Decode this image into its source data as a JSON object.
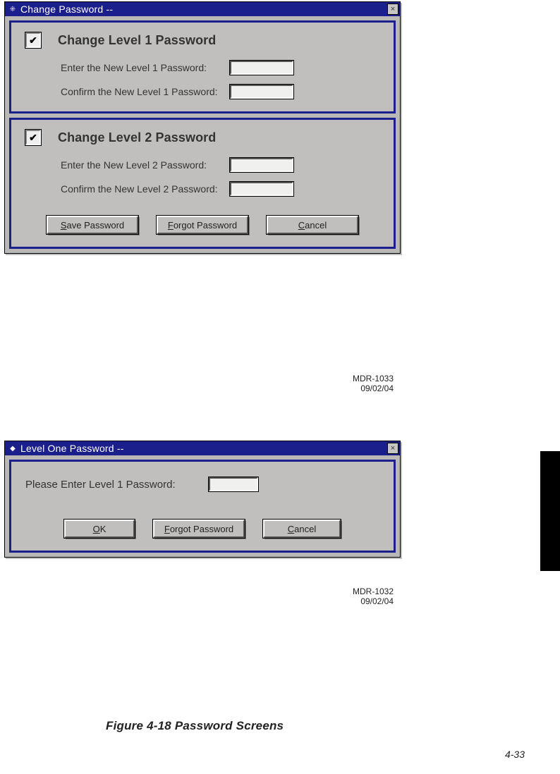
{
  "dialog1": {
    "title": "Change Password --",
    "close": "×",
    "section1": {
      "checkbox_checked": true,
      "heading": "Change Level 1 Password",
      "enter_label": "Enter the New Level 1 Password:",
      "confirm_label": "Confirm the New Level 1 Password:"
    },
    "section2": {
      "checkbox_checked": true,
      "heading": "Change Level 2 Password",
      "enter_label": "Enter the New Level 2 Password:",
      "confirm_label": "Confirm the New Level 2 Password:"
    },
    "buttons": {
      "save_mn": "S",
      "save_rest": "ave Password",
      "forgot_mn": "F",
      "forgot_rest": "orgot Password",
      "cancel_mn": "C",
      "cancel_rest": "ancel"
    },
    "ref_id": "MDR-1033",
    "ref_date": "09/02/04"
  },
  "dialog2": {
    "title": "Level One Password --",
    "close": "×",
    "prompt": "Please Enter Level 1 Password:",
    "buttons": {
      "ok_mn": "O",
      "ok_rest": "K",
      "forgot_mn": "F",
      "forgot_rest": "orgot Password",
      "cancel_mn": "C",
      "cancel_rest": "ancel"
    },
    "ref_id": "MDR-1032",
    "ref_date": "09/02/04"
  },
  "figure_caption": "Figure 4-18  Password Screens",
  "page_number": "4-33",
  "icons": {
    "checkmark": "✔"
  }
}
